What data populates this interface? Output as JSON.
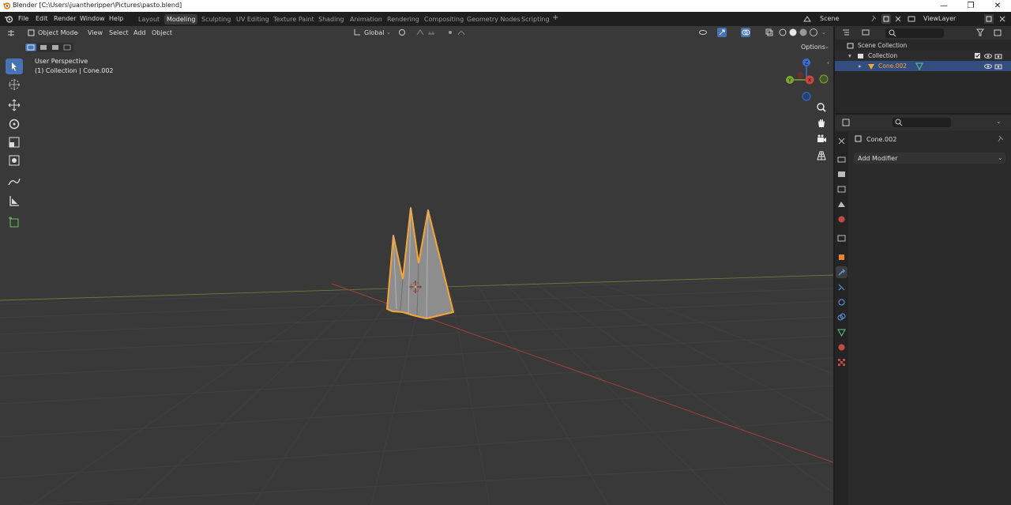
{
  "window": {
    "title": "Blender [C:\\Users\\juantheripper\\Pictures\\pasto.blend]",
    "minimize": "—",
    "maximize": "❐",
    "close": "✕"
  },
  "menus": [
    "File",
    "Edit",
    "Render",
    "Window",
    "Help"
  ],
  "workspaces": [
    {
      "label": "Layout",
      "active": false
    },
    {
      "label": "Modeling",
      "active": true
    },
    {
      "label": "Sculpting",
      "active": false
    },
    {
      "label": "UV Editing",
      "active": false
    },
    {
      "label": "Texture Paint",
      "active": false
    },
    {
      "label": "Shading",
      "active": false
    },
    {
      "label": "Animation",
      "active": false
    },
    {
      "label": "Rendering",
      "active": false
    },
    {
      "label": "Compositing",
      "active": false
    },
    {
      "label": "Geometry Nodes",
      "active": false
    },
    {
      "label": "Scripting",
      "active": false
    }
  ],
  "add_workspace": "+",
  "scene": {
    "value": "Scene"
  },
  "view_layer": {
    "value": "ViewLayer"
  },
  "viewport_header": {
    "mode": "Object Mode",
    "menus": [
      "View",
      "Select",
      "Add",
      "Object"
    ],
    "transform_orientation": "Global",
    "options": "Options"
  },
  "viewport_overlay": {
    "perspective": "User Perspective",
    "collection": "(1) Collection | Cone.002"
  },
  "gizmo": {
    "x": "X",
    "y": "Y",
    "z": "Z"
  },
  "outliner": {
    "root": "Scene Collection",
    "collection": "Collection",
    "object": "Cone.002"
  },
  "properties": {
    "object_name": "Cone.002",
    "add_modifier": "Add Modifier"
  },
  "colors": {
    "accent_blue": "#4772b3",
    "selection_orange": "#f5a43a",
    "axis_red": "#c8463f",
    "axis_green": "#78a62e",
    "axis_blue": "#3a6fd6"
  }
}
